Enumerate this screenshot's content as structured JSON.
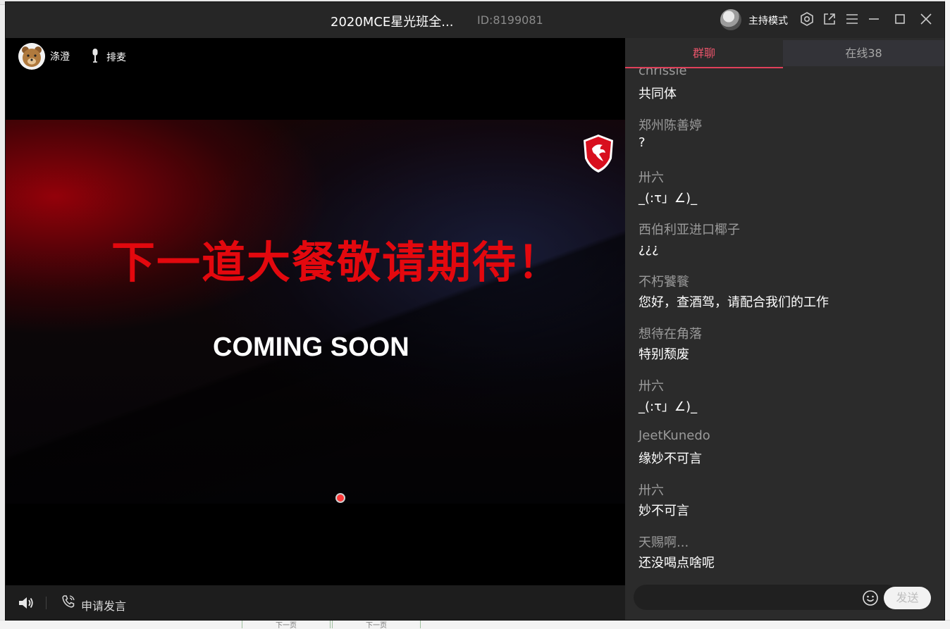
{
  "window": {
    "title": "2020MCE星光班全...",
    "room_id": "ID:8199081",
    "host_mode_label": "主持模式",
    "icons": [
      "settings-icon",
      "popout-icon",
      "menu-icon",
      "minimize-icon",
      "maximize-icon",
      "close-icon"
    ]
  },
  "video": {
    "presenter_name": "涤澄",
    "queue_label": "排麦",
    "slide_headline": "下一道大餐敬请期待！",
    "slide_subtitle": "COMING SOON",
    "controls": {
      "request_speak": "申请发言"
    }
  },
  "chat": {
    "tab_group": "群聊",
    "tab_online": "在线38",
    "messages": [
      {
        "name": "chrissie",
        "text": "共同体"
      },
      {
        "name": "郑州陈善婷",
        "text": "?"
      },
      {
        "name": "卅六",
        "text": "_(:τ」∠)_"
      },
      {
        "name": "西伯利亚进口椰子",
        "text": "¿¿¿"
      },
      {
        "name": "不朽饕餮",
        "text": "您好，查酒驾，请配合我们的工作"
      },
      {
        "name": "想待在角落",
        "text": "特别颓废"
      },
      {
        "name": "卅六",
        "text": "_(:τ」∠)_"
      },
      {
        "name": "JeetKunedo",
        "text": "缘妙不可言"
      },
      {
        "name": "卅六",
        "text": "妙不可言"
      },
      {
        "name": "天赐啊...",
        "text": "还没喝点啥呢"
      }
    ],
    "input_placeholder": "",
    "send_label": "发送"
  },
  "background": {
    "tab_1": "下一页",
    "tab_2": "下一页"
  },
  "colors": {
    "accent": "#e0405a",
    "headline_red": "#e3080e",
    "chat_bg": "#2b2b2b",
    "titlebar_bg": "#262626"
  }
}
